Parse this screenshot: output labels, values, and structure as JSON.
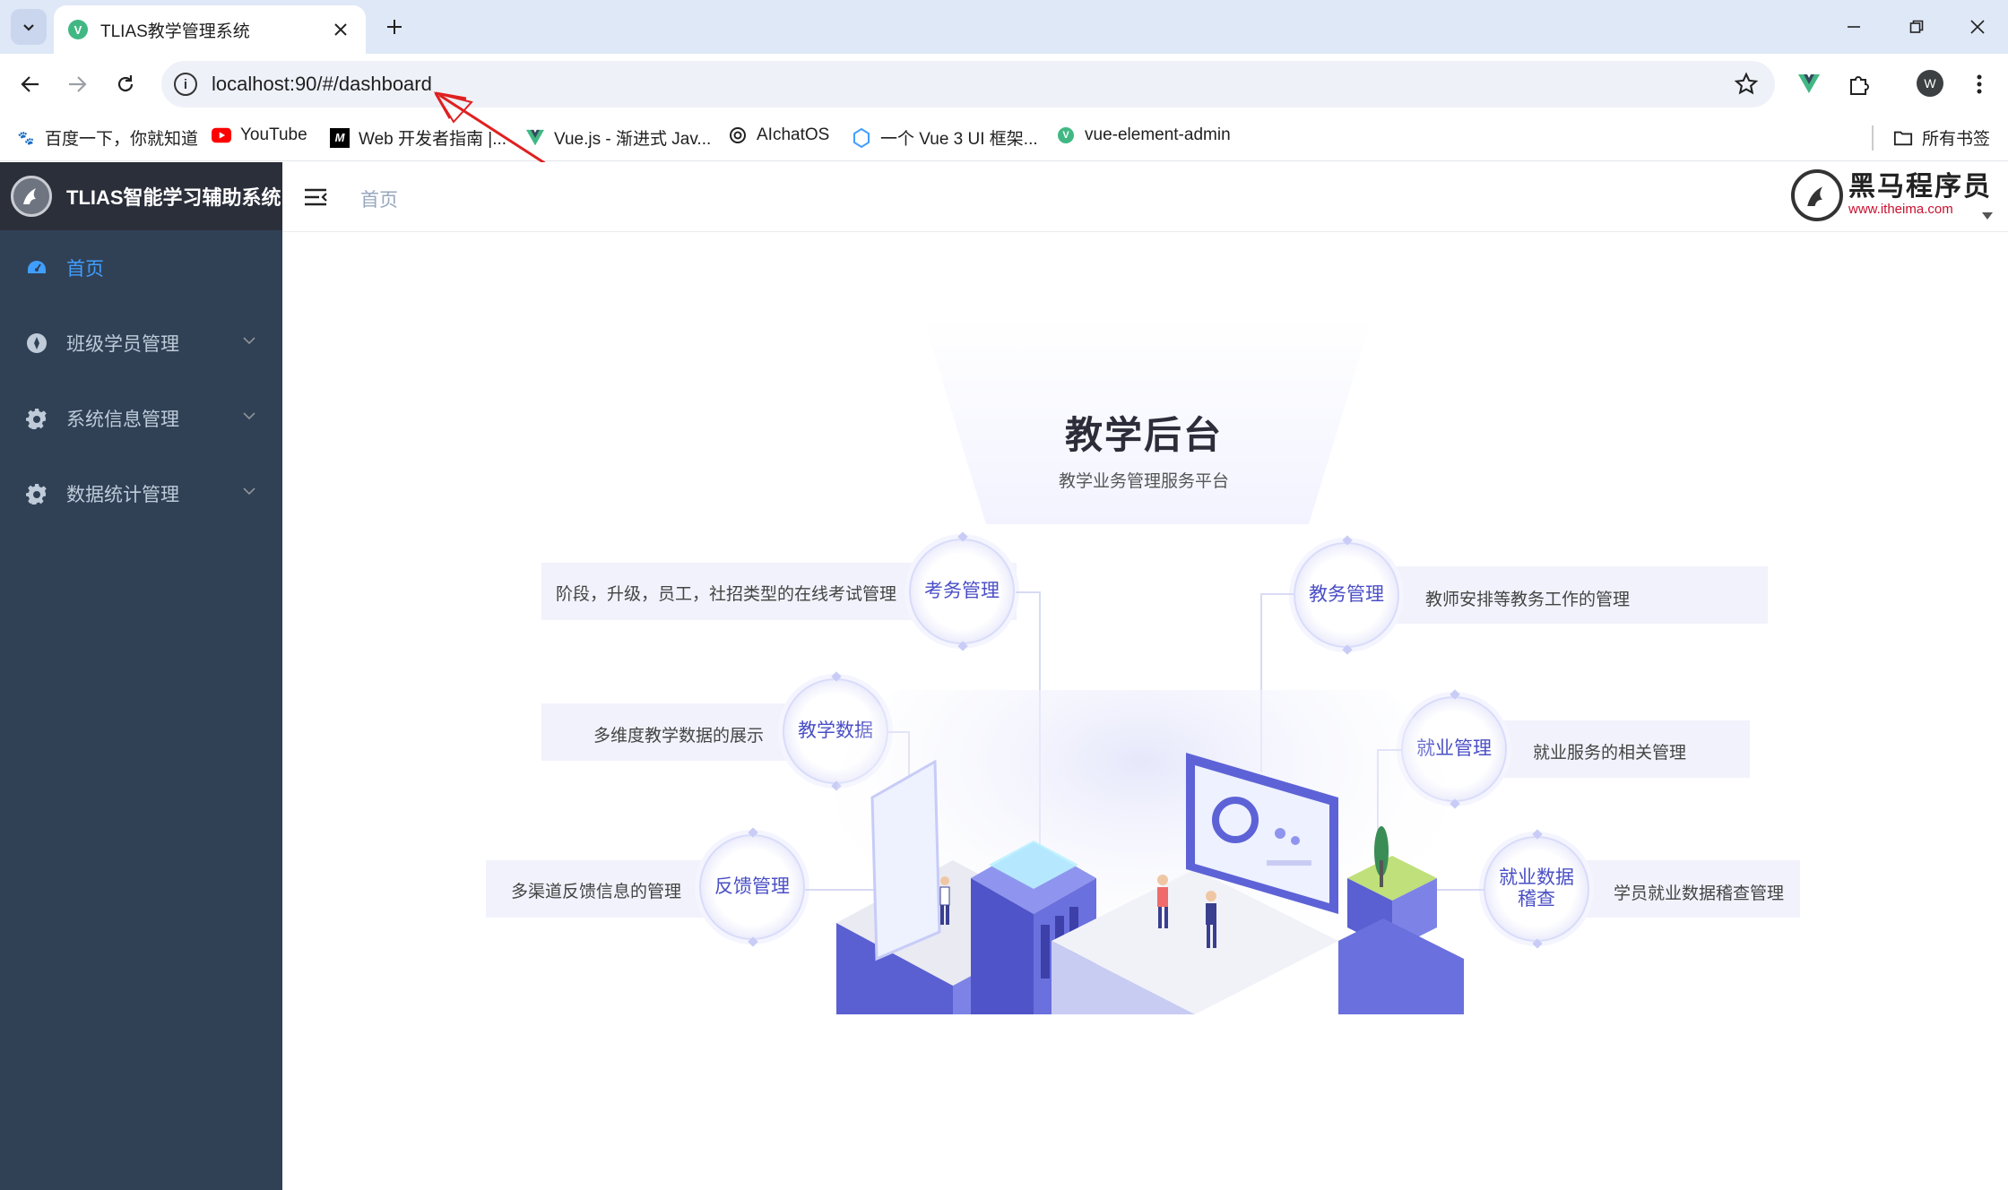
{
  "browser": {
    "tab_title": "TLIAS教学管理系统",
    "url": "localhost:90/#/dashboard",
    "avatar_letter": "W",
    "bookmarks": [
      {
        "label": "百度一下，你就知道",
        "icon": "baidu-icon"
      },
      {
        "label": "YouTube",
        "icon": "youtube-icon"
      },
      {
        "label": "Web 开发者指南 |...",
        "icon": "mdn-icon"
      },
      {
        "label": "Vue.js - 渐进式 Jav...",
        "icon": "vue-icon"
      },
      {
        "label": "AIchatOS",
        "icon": "openai-icon"
      },
      {
        "label": "一个 Vue 3 UI 框架...",
        "icon": "element-plus-icon"
      },
      {
        "label": "vue-element-admin",
        "icon": "vue-icon"
      }
    ],
    "all_bookmarks": "所有书签"
  },
  "app": {
    "system_title": "TLIAS智能学习辅助系统",
    "menu": [
      {
        "label": "首页",
        "icon": "dashboard-icon",
        "active": true
      },
      {
        "label": "班级学员管理",
        "icon": "compass-icon",
        "active": false
      },
      {
        "label": "系统信息管理",
        "icon": "gear-icon",
        "active": false
      },
      {
        "label": "数据统计管理",
        "icon": "gear-icon",
        "active": false
      }
    ],
    "breadcrumb": "首页",
    "brand": {
      "name": "黑马程序员",
      "url": "www.itheima.com"
    }
  },
  "dashboard": {
    "title": "教学后台",
    "subtitle": "教学业务管理服务平台",
    "modules": [
      {
        "name": "考务管理",
        "desc": "阶段，升级，员工，社招类型的在线考试管理"
      },
      {
        "name": "教学数据",
        "desc": "多维度教学数据的展示"
      },
      {
        "name": "反馈管理",
        "desc": "多渠道反馈信息的管理"
      },
      {
        "name": "教务管理",
        "desc": "教师安排等教务工作的管理"
      },
      {
        "name": "就业管理",
        "desc": "就业服务的相关管理"
      },
      {
        "name": "就业数据",
        "name_line2": "稽查",
        "desc": "学员就业数据稽查管理"
      }
    ]
  },
  "colors": {
    "sidebar_bg": "#304156",
    "logo_bar_bg": "#2b2f3a",
    "menu_active": "#409eff",
    "menu_text": "#bfcbd9",
    "module_text": "#4a4fc6",
    "annotation_arrow": "#e02020"
  }
}
